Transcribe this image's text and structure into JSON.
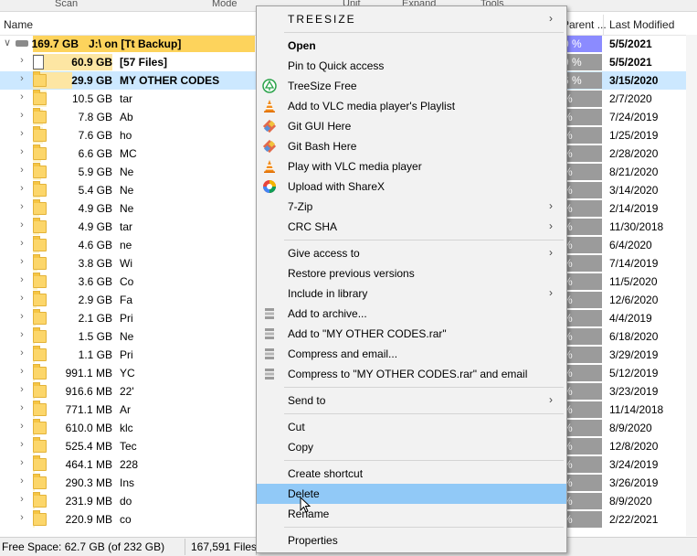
{
  "top_tabs": [
    "Scan",
    "Mode",
    "Unit",
    "Expand",
    "Tools"
  ],
  "columns": {
    "name": "Name",
    "parent_percent": "Parent ...",
    "last_modified": "Last Modified"
  },
  "rows": [
    {
      "size": "169.7 GB",
      "name": "J:\\  on  [Tt Backup]",
      "pct": "100.0 %",
      "pct_visible": "0 %",
      "date": "5/5/2021",
      "kind": "drive",
      "bold": true,
      "sizebar": 1.0
    },
    {
      "size": "60.9 GB",
      "name": "[57 Files]",
      "pct_visible": "9 %",
      "date": "5/5/2021",
      "kind": "file",
      "bold": true,
      "sizebar": 0.359
    },
    {
      "size": "29.9 GB",
      "name": "MY OTHER CODES",
      "pct_visible": "6 %",
      "date": "3/15/2020",
      "kind": "folder",
      "bold": true,
      "selected": true,
      "sizebar": 0.176
    },
    {
      "size": "10.5 GB",
      "name": "tar",
      "pct_visible": "%",
      "date": "2/7/2020",
      "kind": "folder",
      "sizebar": 0.062
    },
    {
      "size": "7.8 GB",
      "name": "Ab",
      "pct_visible": "%",
      "date": "7/24/2019",
      "kind": "folder",
      "sizebar": 0.046
    },
    {
      "size": "7.6 GB",
      "name": "ho",
      "pct_visible": "%",
      "date": "1/25/2019",
      "kind": "folder",
      "sizebar": 0.045
    },
    {
      "size": "6.6 GB",
      "name": "MC",
      "pct_visible": "%",
      "date": "2/28/2020",
      "kind": "folder",
      "sizebar": 0.039
    },
    {
      "size": "5.9 GB",
      "name": "Ne",
      "pct_visible": "%",
      "date": "8/21/2020",
      "kind": "folder",
      "sizebar": 0.035
    },
    {
      "size": "5.4 GB",
      "name": "Ne",
      "pct_visible": "%",
      "date": "3/14/2020",
      "kind": "folder",
      "sizebar": 0.032
    },
    {
      "size": "4.9 GB",
      "name": "Ne",
      "pct_visible": "%",
      "date": "2/14/2019",
      "kind": "folder",
      "sizebar": 0.029
    },
    {
      "size": "4.9 GB",
      "name": "tar",
      "pct_visible": "%",
      "date": "11/30/2018",
      "kind": "folder",
      "sizebar": 0.029
    },
    {
      "size": "4.6 GB",
      "name": "ne",
      "pct_visible": "%",
      "date": "6/4/2020",
      "kind": "folder",
      "sizebar": 0.027
    },
    {
      "size": "3.8 GB",
      "name": "Wi",
      "pct_visible": "%",
      "date": "7/14/2019",
      "kind": "folder",
      "sizebar": 0.022
    },
    {
      "size": "3.6 GB",
      "name": "Co",
      "pct_visible": "%",
      "date": "11/5/2020",
      "kind": "folder",
      "sizebar": 0.021
    },
    {
      "size": "2.9 GB",
      "name": "Fa",
      "pct_visible": "%",
      "date": "12/6/2020",
      "kind": "folder",
      "sizebar": 0.017
    },
    {
      "size": "2.1 GB",
      "name": "Pri",
      "pct_visible": "%",
      "date": "4/4/2019",
      "kind": "folder",
      "sizebar": 0.012
    },
    {
      "size": "1.5 GB",
      "name": "Ne",
      "pct_visible": "%",
      "date": "6/18/2020",
      "kind": "folder",
      "sizebar": 0.009
    },
    {
      "size": "1.1 GB",
      "name": "Pri",
      "pct_visible": "%",
      "date": "3/29/2019",
      "kind": "folder",
      "sizebar": 0.006
    },
    {
      "size": "991.1 MB",
      "name": "YC",
      "pct_visible": "%",
      "date": "5/12/2019",
      "kind": "folder",
      "sizebar": 0.006
    },
    {
      "size": "916.6 MB",
      "name": "22'",
      "pct_visible": "%",
      "date": "3/23/2019",
      "kind": "folder",
      "sizebar": 0.005
    },
    {
      "size": "771.1 MB",
      "name": "Ar",
      "pct_visible": "%",
      "date": "11/14/2018",
      "kind": "folder",
      "sizebar": 0.004
    },
    {
      "size": "610.0 MB",
      "name": "klc",
      "pct_visible": "%",
      "date": "8/9/2020",
      "kind": "folder",
      "sizebar": 0.004
    },
    {
      "size": "525.4 MB",
      "name": "Tec",
      "pct_visible": "%",
      "date": "12/8/2020",
      "kind": "folder",
      "sizebar": 0.003
    },
    {
      "size": "464.1 MB",
      "name": "228",
      "pct_visible": "%",
      "date": "3/24/2019",
      "kind": "folder",
      "sizebar": 0.003
    },
    {
      "size": "290.3 MB",
      "name": "Ins",
      "pct_visible": "%",
      "date": "3/26/2019",
      "kind": "folder",
      "sizebar": 0.002
    },
    {
      "size": "231.9 MB",
      "name": "do",
      "pct_visible": "%",
      "date": "8/9/2020",
      "kind": "folder",
      "sizebar": 0.001
    },
    {
      "size": "220.9 MB",
      "name": "co",
      "pct_visible": "%",
      "date": "2/22/2021",
      "kind": "folder",
      "sizebar": 0.001
    }
  ],
  "status": {
    "free_space": "Free Space: 62.7 GB  (of 232 GB)",
    "files": "167,591 Files"
  },
  "menu": {
    "items": [
      {
        "type": "item",
        "label": "TREESIZE",
        "style": "title",
        "submenu": true
      },
      {
        "type": "sep"
      },
      {
        "type": "item",
        "label": "Open",
        "style": "strong"
      },
      {
        "type": "item",
        "label": "Pin to Quick access"
      },
      {
        "type": "item",
        "label": "TreeSize Free",
        "icon": "treesize-icon"
      },
      {
        "type": "item",
        "label": "Add to VLC media player's Playlist",
        "icon": "vlc-icon"
      },
      {
        "type": "item",
        "label": "Git GUI Here",
        "icon": "git-icon"
      },
      {
        "type": "item",
        "label": "Git Bash Here",
        "icon": "git-icon"
      },
      {
        "type": "item",
        "label": "Play with VLC media player",
        "icon": "vlc-icon"
      },
      {
        "type": "item",
        "label": "Upload with ShareX",
        "icon": "sharex-icon"
      },
      {
        "type": "item",
        "label": "7-Zip",
        "submenu": true
      },
      {
        "type": "item",
        "label": "CRC SHA",
        "submenu": true
      },
      {
        "type": "sep"
      },
      {
        "type": "item",
        "label": "Give access to",
        "submenu": true
      },
      {
        "type": "item",
        "label": "Restore previous versions"
      },
      {
        "type": "item",
        "label": "Include in library",
        "submenu": true
      },
      {
        "type": "item",
        "label": "Add to archive...",
        "icon": "winrar-icon"
      },
      {
        "type": "item",
        "label": "Add to \"MY OTHER CODES.rar\"",
        "icon": "winrar-icon"
      },
      {
        "type": "item",
        "label": "Compress and email...",
        "icon": "winrar-icon"
      },
      {
        "type": "item",
        "label": "Compress to \"MY OTHER CODES.rar\" and email",
        "icon": "winrar-icon"
      },
      {
        "type": "sep"
      },
      {
        "type": "item",
        "label": "Send to",
        "submenu": true
      },
      {
        "type": "sep"
      },
      {
        "type": "item",
        "label": "Cut"
      },
      {
        "type": "item",
        "label": "Copy"
      },
      {
        "type": "sep"
      },
      {
        "type": "item",
        "label": "Create shortcut"
      },
      {
        "type": "item",
        "label": "Delete",
        "hover": true
      },
      {
        "type": "item",
        "label": "Rename"
      },
      {
        "type": "sep"
      },
      {
        "type": "item",
        "label": "Properties"
      }
    ]
  },
  "colors": {
    "selection": "#cce8ff",
    "menu_hover": "#91c9f7",
    "root_bar": "#fdd35c",
    "pct_bar": "#9b9b9b",
    "pct_root": "#8b8bff"
  }
}
